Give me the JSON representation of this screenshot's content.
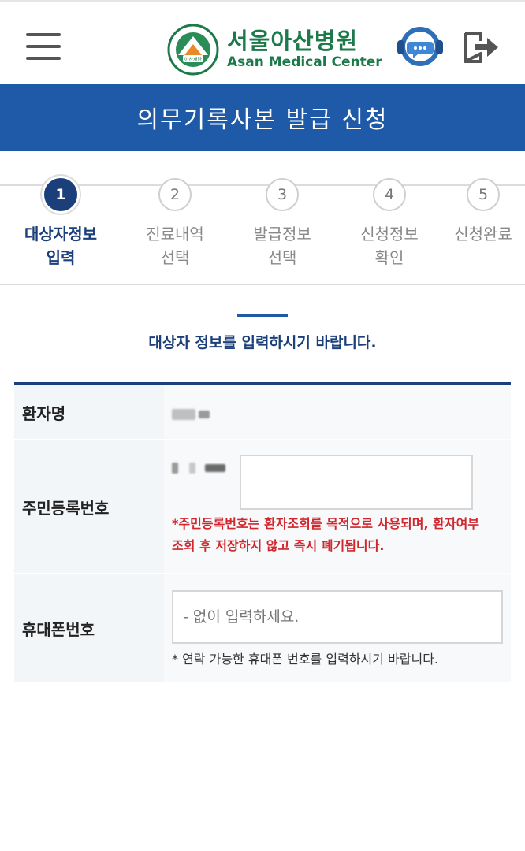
{
  "header": {
    "menu_icon": "hamburger-menu-icon",
    "logo_ko": "서울아산병원",
    "logo_en": "Asan Medical Center",
    "emblem_small_text": "아산재단",
    "emblem_ring_text": "ASAN FOUNDATION",
    "chat_icon": "chatbot-headset-icon",
    "logout_icon": "logout-icon"
  },
  "page_title": "의무기록사본 발급 신청",
  "steps": [
    {
      "number": "1",
      "label_line1": "대상자정보",
      "label_line2": "입력",
      "active": true
    },
    {
      "number": "2",
      "label_line1": "진료내역",
      "label_line2": "선택",
      "active": false
    },
    {
      "number": "3",
      "label_line1": "발급정보",
      "label_line2": "선택",
      "active": false
    },
    {
      "number": "4",
      "label_line1": "신청정보",
      "label_line2": "확인",
      "active": false
    },
    {
      "number": "5",
      "label_line1": "신청완료",
      "label_line2": "",
      "active": false
    }
  ],
  "section_message": "대상자 정보를 입력하시기 바랍니다.",
  "form": {
    "patient_name_label": "환자명",
    "resident_number_label": "주민등록번호",
    "resident_warning": "*주민등록번호는 환자조회를 목적으로 사용되며, 환자여부 조회 후 저장하지 않고 즉시 폐기됩니다.",
    "phone_label": "휴대폰번호",
    "phone_placeholder": "- 없이 입력하세요.",
    "phone_hint": "* 연락 가능한 휴대폰 번호를 입력하시기 바랍니다."
  },
  "colors": {
    "brand_blue": "#1e5aa8",
    "navy": "#1b3f7a",
    "logo_green": "#1c7a4a",
    "warning_red": "#d0262c"
  }
}
